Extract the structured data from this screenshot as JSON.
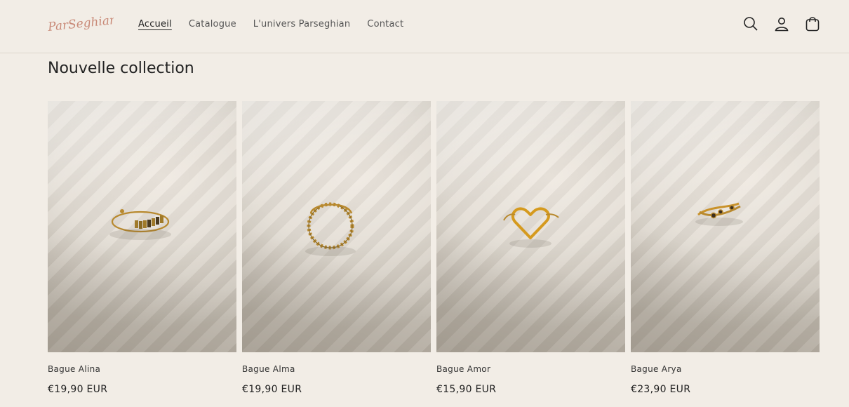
{
  "brand": {
    "logo_text": "ParSeghian"
  },
  "nav": {
    "items": [
      {
        "label": "Accueil",
        "active": true
      },
      {
        "label": "Catalogue",
        "active": false
      },
      {
        "label": "L'univers Parseghian",
        "active": false
      },
      {
        "label": "Contact",
        "active": false
      }
    ]
  },
  "header_icons": [
    "search-icon",
    "account-icon",
    "cart-icon"
  ],
  "section": {
    "title": "Nouvelle collection"
  },
  "products": [
    {
      "name": "Bague Alina",
      "price": "€19,90 EUR"
    },
    {
      "name": "Bague Alma",
      "price": "€19,90 EUR"
    },
    {
      "name": "Bague Amor",
      "price": "€15,90 EUR"
    },
    {
      "name": "Bague Arya",
      "price": "€23,90 EUR"
    }
  ],
  "colors": {
    "background": "#f2ede6",
    "logo": "#c98a78",
    "gold": "#b8892e"
  }
}
